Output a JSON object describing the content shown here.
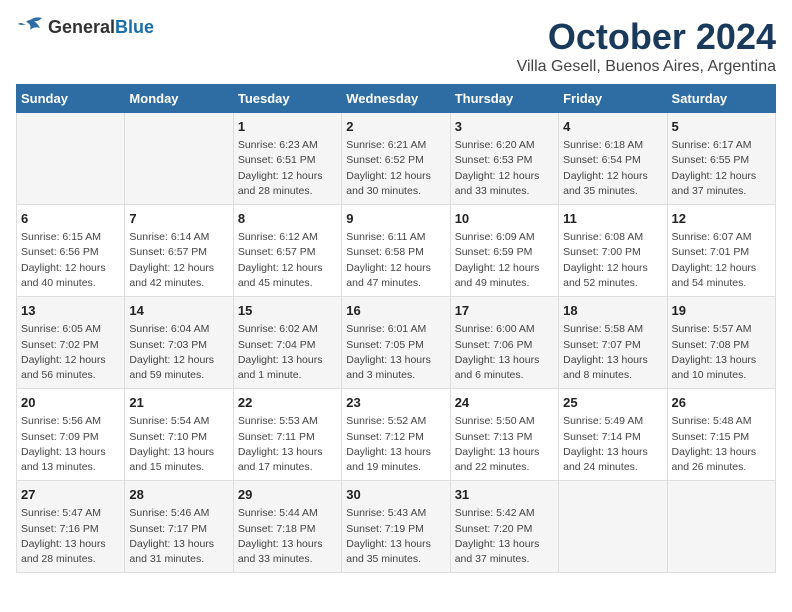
{
  "logo": {
    "general": "General",
    "blue": "Blue"
  },
  "title": "October 2024",
  "location": "Villa Gesell, Buenos Aires, Argentina",
  "weekdays": [
    "Sunday",
    "Monday",
    "Tuesday",
    "Wednesday",
    "Thursday",
    "Friday",
    "Saturday"
  ],
  "weeks": [
    [
      {
        "day": "",
        "info": ""
      },
      {
        "day": "",
        "info": ""
      },
      {
        "day": "1",
        "info": "Sunrise: 6:23 AM\nSunset: 6:51 PM\nDaylight: 12 hours and 28 minutes."
      },
      {
        "day": "2",
        "info": "Sunrise: 6:21 AM\nSunset: 6:52 PM\nDaylight: 12 hours and 30 minutes."
      },
      {
        "day": "3",
        "info": "Sunrise: 6:20 AM\nSunset: 6:53 PM\nDaylight: 12 hours and 33 minutes."
      },
      {
        "day": "4",
        "info": "Sunrise: 6:18 AM\nSunset: 6:54 PM\nDaylight: 12 hours and 35 minutes."
      },
      {
        "day": "5",
        "info": "Sunrise: 6:17 AM\nSunset: 6:55 PM\nDaylight: 12 hours and 37 minutes."
      }
    ],
    [
      {
        "day": "6",
        "info": "Sunrise: 6:15 AM\nSunset: 6:56 PM\nDaylight: 12 hours and 40 minutes."
      },
      {
        "day": "7",
        "info": "Sunrise: 6:14 AM\nSunset: 6:57 PM\nDaylight: 12 hours and 42 minutes."
      },
      {
        "day": "8",
        "info": "Sunrise: 6:12 AM\nSunset: 6:57 PM\nDaylight: 12 hours and 45 minutes."
      },
      {
        "day": "9",
        "info": "Sunrise: 6:11 AM\nSunset: 6:58 PM\nDaylight: 12 hours and 47 minutes."
      },
      {
        "day": "10",
        "info": "Sunrise: 6:09 AM\nSunset: 6:59 PM\nDaylight: 12 hours and 49 minutes."
      },
      {
        "day": "11",
        "info": "Sunrise: 6:08 AM\nSunset: 7:00 PM\nDaylight: 12 hours and 52 minutes."
      },
      {
        "day": "12",
        "info": "Sunrise: 6:07 AM\nSunset: 7:01 PM\nDaylight: 12 hours and 54 minutes."
      }
    ],
    [
      {
        "day": "13",
        "info": "Sunrise: 6:05 AM\nSunset: 7:02 PM\nDaylight: 12 hours and 56 minutes."
      },
      {
        "day": "14",
        "info": "Sunrise: 6:04 AM\nSunset: 7:03 PM\nDaylight: 12 hours and 59 minutes."
      },
      {
        "day": "15",
        "info": "Sunrise: 6:02 AM\nSunset: 7:04 PM\nDaylight: 13 hours and 1 minute."
      },
      {
        "day": "16",
        "info": "Sunrise: 6:01 AM\nSunset: 7:05 PM\nDaylight: 13 hours and 3 minutes."
      },
      {
        "day": "17",
        "info": "Sunrise: 6:00 AM\nSunset: 7:06 PM\nDaylight: 13 hours and 6 minutes."
      },
      {
        "day": "18",
        "info": "Sunrise: 5:58 AM\nSunset: 7:07 PM\nDaylight: 13 hours and 8 minutes."
      },
      {
        "day": "19",
        "info": "Sunrise: 5:57 AM\nSunset: 7:08 PM\nDaylight: 13 hours and 10 minutes."
      }
    ],
    [
      {
        "day": "20",
        "info": "Sunrise: 5:56 AM\nSunset: 7:09 PM\nDaylight: 13 hours and 13 minutes."
      },
      {
        "day": "21",
        "info": "Sunrise: 5:54 AM\nSunset: 7:10 PM\nDaylight: 13 hours and 15 minutes."
      },
      {
        "day": "22",
        "info": "Sunrise: 5:53 AM\nSunset: 7:11 PM\nDaylight: 13 hours and 17 minutes."
      },
      {
        "day": "23",
        "info": "Sunrise: 5:52 AM\nSunset: 7:12 PM\nDaylight: 13 hours and 19 minutes."
      },
      {
        "day": "24",
        "info": "Sunrise: 5:50 AM\nSunset: 7:13 PM\nDaylight: 13 hours and 22 minutes."
      },
      {
        "day": "25",
        "info": "Sunrise: 5:49 AM\nSunset: 7:14 PM\nDaylight: 13 hours and 24 minutes."
      },
      {
        "day": "26",
        "info": "Sunrise: 5:48 AM\nSunset: 7:15 PM\nDaylight: 13 hours and 26 minutes."
      }
    ],
    [
      {
        "day": "27",
        "info": "Sunrise: 5:47 AM\nSunset: 7:16 PM\nDaylight: 13 hours and 28 minutes."
      },
      {
        "day": "28",
        "info": "Sunrise: 5:46 AM\nSunset: 7:17 PM\nDaylight: 13 hours and 31 minutes."
      },
      {
        "day": "29",
        "info": "Sunrise: 5:44 AM\nSunset: 7:18 PM\nDaylight: 13 hours and 33 minutes."
      },
      {
        "day": "30",
        "info": "Sunrise: 5:43 AM\nSunset: 7:19 PM\nDaylight: 13 hours and 35 minutes."
      },
      {
        "day": "31",
        "info": "Sunrise: 5:42 AM\nSunset: 7:20 PM\nDaylight: 13 hours and 37 minutes."
      },
      {
        "day": "",
        "info": ""
      },
      {
        "day": "",
        "info": ""
      }
    ]
  ]
}
